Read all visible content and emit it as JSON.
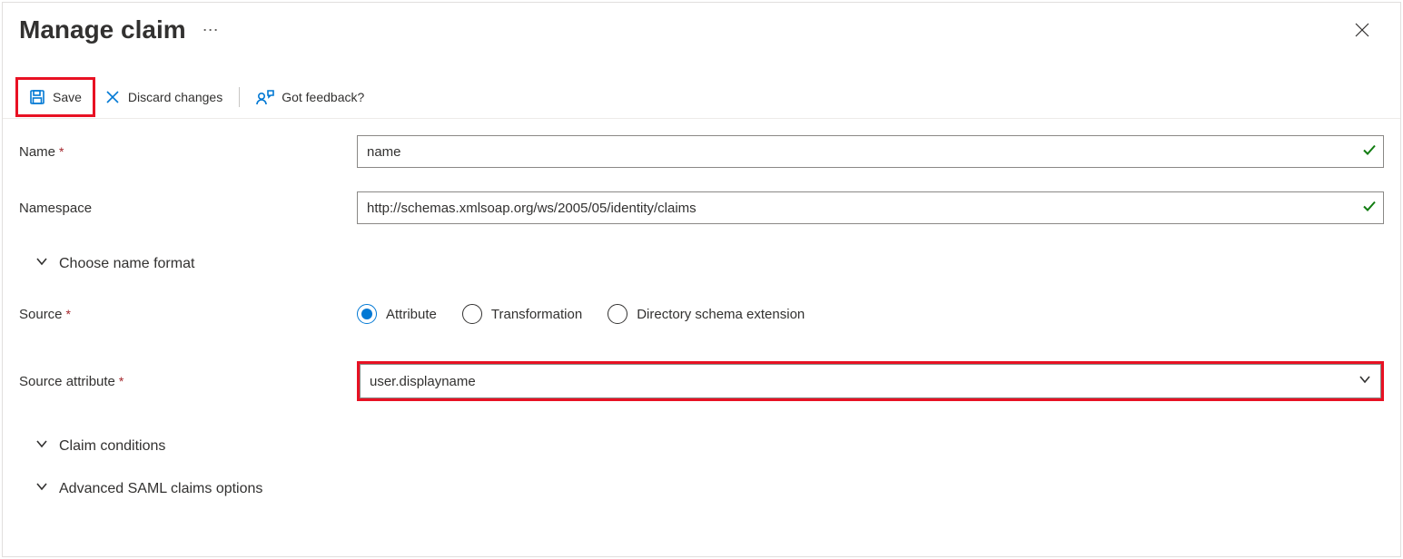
{
  "header": {
    "title": "Manage claim",
    "ellipsis": "⋯"
  },
  "toolbar": {
    "save_label": "Save",
    "discard_label": "Discard changes",
    "feedback_label": "Got feedback?"
  },
  "form": {
    "name": {
      "label": "Name",
      "value": "name"
    },
    "namespace": {
      "label": "Namespace",
      "value": "http://schemas.xmlsoap.org/ws/2005/05/identity/claims"
    },
    "choose_name_format": {
      "label": "Choose name format"
    },
    "source": {
      "label": "Source",
      "options": [
        {
          "label": "Attribute",
          "checked": true
        },
        {
          "label": "Transformation",
          "checked": false
        },
        {
          "label": "Directory schema extension",
          "checked": false
        }
      ]
    },
    "source_attribute": {
      "label": "Source attribute",
      "value": "user.displayname"
    },
    "claim_conditions": {
      "label": "Claim conditions"
    },
    "advanced_saml": {
      "label": "Advanced SAML claims options"
    }
  }
}
